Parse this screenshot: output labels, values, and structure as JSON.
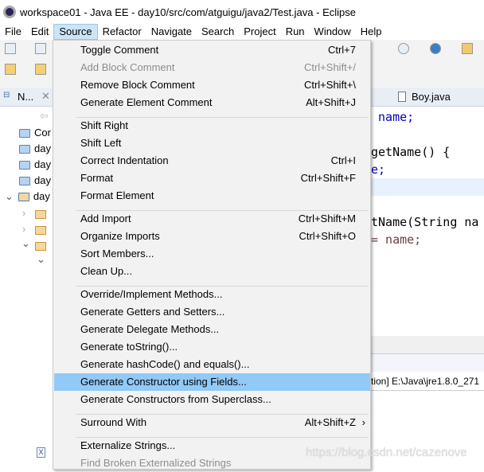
{
  "window": {
    "title": "workspace01 - Java EE - day10/src/com/atguigu/java2/Test.java - Eclipse"
  },
  "menubar": [
    "File",
    "Edit",
    "Source",
    "Refactor",
    "Navigate",
    "Search",
    "Project",
    "Run",
    "Window",
    "Help"
  ],
  "panel": {
    "tab": "N...",
    "tree": [
      "Cor",
      "day",
      "day",
      "day",
      "day"
    ]
  },
  "editor": {
    "tab": "Boy.java",
    "lines": [
      " name;",
      "",
      "getName() {",
      "e;",
      "",
      "tName(String na",
      "= name;"
    ]
  },
  "console": {
    "text": "tion] E:\\Java\\jre1.8.0_271"
  },
  "source_menu": {
    "groups": [
      [
        {
          "label": "Toggle Comment",
          "shortcut": "Ctrl+7"
        },
        {
          "label": "Add Block Comment",
          "shortcut": "Ctrl+Shift+/",
          "disabled": true
        },
        {
          "label": "Remove Block Comment",
          "shortcut": "Ctrl+Shift+\\"
        },
        {
          "label": "Generate Element Comment",
          "shortcut": "Alt+Shift+J"
        }
      ],
      [
        {
          "label": "Shift Right"
        },
        {
          "label": "Shift Left"
        },
        {
          "label": "Correct Indentation",
          "shortcut": "Ctrl+I"
        },
        {
          "label": "Format",
          "shortcut": "Ctrl+Shift+F"
        },
        {
          "label": "Format Element"
        }
      ],
      [
        {
          "label": "Add Import",
          "shortcut": "Ctrl+Shift+M"
        },
        {
          "label": "Organize Imports",
          "shortcut": "Ctrl+Shift+O"
        },
        {
          "label": "Sort Members..."
        },
        {
          "label": "Clean Up..."
        }
      ],
      [
        {
          "label": "Override/Implement Methods..."
        },
        {
          "label": "Generate Getters and Setters..."
        },
        {
          "label": "Generate Delegate Methods..."
        },
        {
          "label": "Generate toString()..."
        },
        {
          "label": "Generate hashCode() and equals()..."
        },
        {
          "label": "Generate Constructor using Fields...",
          "highlighted": true
        },
        {
          "label": "Generate Constructors from Superclass..."
        }
      ],
      [
        {
          "label": "Surround With",
          "shortcut": "Alt+Shift+Z",
          "submenu": true
        }
      ],
      [
        {
          "label": "Externalize Strings..."
        },
        {
          "label": "Find Broken Externalized Strings",
          "disabled": true
        }
      ]
    ]
  },
  "watermark": "https://blog.csdn.net/cazenove",
  "colors": {
    "highlight": "#91c9f7",
    "menu_bg": "#f2f2f2",
    "keyword": "#0000c0",
    "field": "#0000c0"
  }
}
